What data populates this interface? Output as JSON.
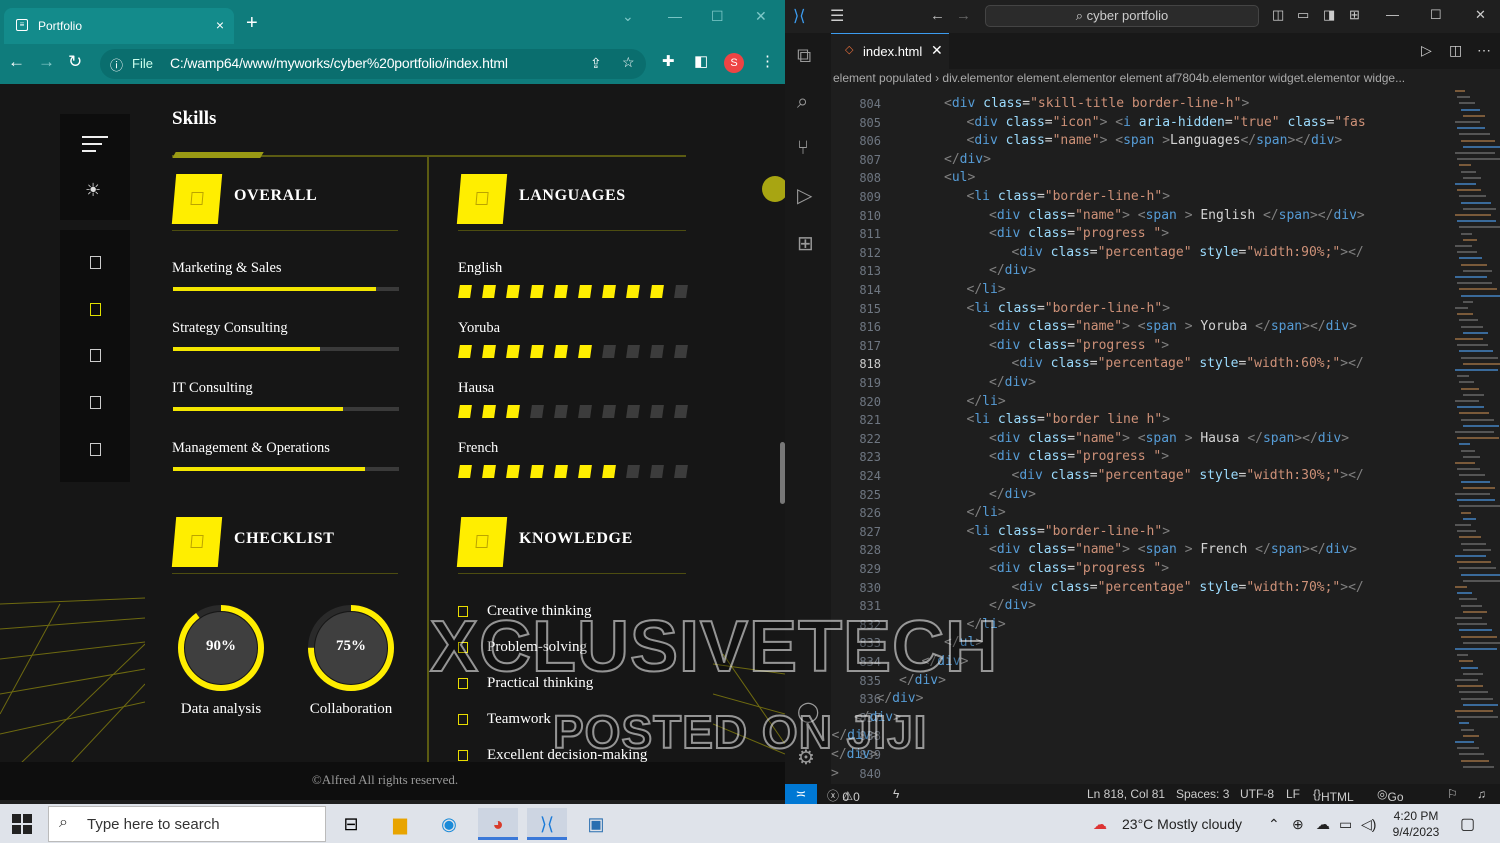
{
  "browser": {
    "tab_title": "Portfolio",
    "tab_close": "×",
    "new_tab": "+",
    "file_label": "File",
    "url": "C:/wamp64/www/myworks/cyber%20portfolio/index.html",
    "avatar_letter": "S"
  },
  "site": {
    "section_title": "Skills",
    "overall": {
      "title": "OVERALL",
      "skills": [
        {
          "name": "Marketing & Sales",
          "percent": 90
        },
        {
          "name": "Strategy Consulting",
          "percent": 65
        },
        {
          "name": "IT Consulting",
          "percent": 75
        },
        {
          "name": "Management & Operations",
          "percent": 85
        }
      ]
    },
    "languages": {
      "title": "LANGUAGES",
      "items": [
        {
          "name": "English",
          "percent": 90
        },
        {
          "name": "Yoruba",
          "percent": 60
        },
        {
          "name": "Hausa",
          "percent": 30
        },
        {
          "name": "French",
          "percent": 70
        }
      ]
    },
    "checklist": {
      "title": "CHECKLIST",
      "items": [
        {
          "label": "Data analysis",
          "value": "90%",
          "percent": 90
        },
        {
          "label": "Collaboration",
          "value": "75%",
          "percent": 75
        }
      ]
    },
    "knowledge": {
      "title": "KNOWLEDGE",
      "items": [
        "Creative thinking",
        "Problem-solving",
        "Practical thinking",
        "Teamwork",
        "Excellent decision-making"
      ]
    },
    "footer": "©Alfred All rights reserved."
  },
  "vscode": {
    "search": "cyber portfolio",
    "tab": "index.html",
    "breadcrumb": "element populated  ›  div.elementor element.elementor element af7804b.elementor widget.elementor widge...",
    "status": {
      "errors": "0",
      "warnings": "0",
      "position": "Ln 818, Col 81",
      "spaces": "Spaces: 3",
      "encoding": "UTF-8",
      "eol": "LF",
      "language": "HTML",
      "golive": "Go Live"
    },
    "current_line": "818",
    "code": [
      {
        "n": "804",
        "i": 0,
        "h": "<span class='p'>&lt;</span><span class='t'>div</span> <span class='a'>class</span>=<span class='s'>\"skill-title border-line-h\"</span><span class='p'>&gt;</span>"
      },
      {
        "n": "805",
        "i": 1,
        "h": "<span class='p'>&lt;</span><span class='t'>div</span> <span class='a'>class</span>=<span class='s'>\"icon\"</span><span class='p'>&gt;</span> <span class='p'>&lt;</span><span class='t'>i</span> <span class='a'>aria-hidden</span>=<span class='s'>\"true\"</span> <span class='a'>class</span>=<span class='s'>\"fas</span>"
      },
      {
        "n": "806",
        "i": 1,
        "h": "<span class='p'>&lt;</span><span class='t'>div</span> <span class='a'>class</span>=<span class='s'>\"name\"</span><span class='p'>&gt;</span> <span class='p'>&lt;</span><span class='t'>span</span> <span class='p'>&gt;</span>Languages<span class='p'>&lt;/</span><span class='t'>span</span><span class='p'>&gt;&lt;/</span><span class='t'>div</span><span class='p'>&gt;</span>"
      },
      {
        "n": "807",
        "i": 0,
        "h": "<span class='p'>&lt;/</span><span class='t'>div</span><span class='p'>&gt;</span>"
      },
      {
        "n": "808",
        "i": 0,
        "h": "<span class='p'>&lt;</span><span class='t'>ul</span><span class='p'>&gt;</span>"
      },
      {
        "n": "809",
        "i": 1,
        "h": "<span class='p'>&lt;</span><span class='t'>li</span> <span class='a'>class</span>=<span class='s'>\"border-line-h\"</span><span class='p'>&gt;</span>"
      },
      {
        "n": "810",
        "i": 2,
        "h": "<span class='p'>&lt;</span><span class='t'>div</span> <span class='a'>class</span>=<span class='s'>\"name\"</span><span class='p'>&gt;</span> <span class='p'>&lt;</span><span class='t'>span</span> <span class='p'>&gt;</span> English <span class='p'>&lt;/</span><span class='t'>span</span><span class='p'>&gt;&lt;/</span><span class='t'>div</span><span class='p'>&gt;</span>"
      },
      {
        "n": "811",
        "i": 2,
        "h": "<span class='p'>&lt;</span><span class='t'>div</span> <span class='a'>class</span>=<span class='s'>\"progress \"</span><span class='p'>&gt;</span>"
      },
      {
        "n": "812",
        "i": 3,
        "h": "<span class='p'>&lt;</span><span class='t'>div</span> <span class='a'>class</span>=<span class='s'>\"percentage\"</span> <span class='a'>style</span>=<span class='s'>\"width:90%;\"</span><span class='p'>&gt;&lt;/</span>"
      },
      {
        "n": "813",
        "i": 2,
        "h": "<span class='p'>&lt;/</span><span class='t'>div</span><span class='p'>&gt;</span>"
      },
      {
        "n": "814",
        "i": 1,
        "h": "<span class='p'>&lt;/</span><span class='t'>li</span><span class='p'>&gt;</span>"
      },
      {
        "n": "815",
        "i": 1,
        "h": "<span class='p'>&lt;</span><span class='t'>li</span> <span class='a'>class</span>=<span class='s'>\"border-line-h\"</span><span class='p'>&gt;</span>"
      },
      {
        "n": "816",
        "i": 2,
        "h": "<span class='p'>&lt;</span><span class='t'>div</span> <span class='a'>class</span>=<span class='s'>\"name\"</span><span class='p'>&gt;</span> <span class='p'>&lt;</span><span class='t'>span</span> <span class='p'>&gt;</span> Yoruba <span class='p'>&lt;/</span><span class='t'>span</span><span class='p'>&gt;&lt;/</span><span class='t'>div</span><span class='p'>&gt;</span>"
      },
      {
        "n": "817",
        "i": 2,
        "h": "<span class='p'>&lt;</span><span class='t'>div</span> <span class='a'>class</span>=<span class='s'>\"progress \"</span><span class='p'>&gt;</span>"
      },
      {
        "n": "818",
        "i": 3,
        "h": "<span class='p'>&lt;</span><span class='t'>div</span> <span class='a'>class</span>=<span class='s'>\"percentage\"</span> <span class='a'>style</span>=<span class='s'>\"width:60%;\"</span><span class='p'>&gt;&lt;/</span>"
      },
      {
        "n": "819",
        "i": 2,
        "h": "<span class='p'>&lt;/</span><span class='t'>div</span><span class='p'>&gt;</span>"
      },
      {
        "n": "820",
        "i": 1,
        "h": "<span class='p'>&lt;/</span><span class='t'>li</span><span class='p'>&gt;</span>"
      },
      {
        "n": "821",
        "i": 1,
        "h": "<span class='p'>&lt;</span><span class='t'>li</span> <span class='a'>class</span>=<span class='s'>\"border line h\"</span><span class='p'>&gt;</span>"
      },
      {
        "n": "822",
        "i": 2,
        "h": "<span class='p'>&lt;</span><span class='t'>div</span> <span class='a'>class</span>=<span class='s'>\"name\"</span><span class='p'>&gt;</span> <span class='p'>&lt;</span><span class='t'>span</span> <span class='p'>&gt;</span> Hausa <span class='p'>&lt;/</span><span class='t'>span</span><span class='p'>&gt;&lt;/</span><span class='t'>div</span><span class='p'>&gt;</span>"
      },
      {
        "n": "823",
        "i": 2,
        "h": "<span class='p'>&lt;</span><span class='t'>div</span> <span class='a'>class</span>=<span class='s'>\"progress \"</span><span class='p'>&gt;</span>"
      },
      {
        "n": "824",
        "i": 3,
        "h": "<span class='p'>&lt;</span><span class='t'>div</span> <span class='a'>class</span>=<span class='s'>\"percentage\"</span> <span class='a'>style</span>=<span class='s'>\"width:30%;\"</span><span class='p'>&gt;&lt;/</span>"
      },
      {
        "n": "825",
        "i": 2,
        "h": "<span class='p'>&lt;/</span><span class='t'>div</span><span class='p'>&gt;</span>"
      },
      {
        "n": "826",
        "i": 1,
        "h": "<span class='p'>&lt;/</span><span class='t'>li</span><span class='p'>&gt;</span>"
      },
      {
        "n": "827",
        "i": 1,
        "h": "<span class='p'>&lt;</span><span class='t'>li</span> <span class='a'>class</span>=<span class='s'>\"border-line-h\"</span><span class='p'>&gt;</span>"
      },
      {
        "n": "828",
        "i": 2,
        "h": "<span class='p'>&lt;</span><span class='t'>div</span> <span class='a'>class</span>=<span class='s'>\"name\"</span><span class='p'>&gt;</span> <span class='p'>&lt;</span><span class='t'>span</span> <span class='p'>&gt;</span> French <span class='p'>&lt;/</span><span class='t'>span</span><span class='p'>&gt;&lt;/</span><span class='t'>div</span><span class='p'>&gt;</span>"
      },
      {
        "n": "829",
        "i": 2,
        "h": "<span class='p'>&lt;</span><span class='t'>div</span> <span class='a'>class</span>=<span class='s'>\"progress \"</span><span class='p'>&gt;</span>"
      },
      {
        "n": "830",
        "i": 3,
        "h": "<span class='p'>&lt;</span><span class='t'>div</span> <span class='a'>class</span>=<span class='s'>\"percentage\"</span> <span class='a'>style</span>=<span class='s'>\"width:70%;\"</span><span class='p'>&gt;&lt;/</span>"
      },
      {
        "n": "831",
        "i": 2,
        "h": "<span class='p'>&lt;/</span><span class='t'>div</span><span class='p'>&gt;</span>"
      },
      {
        "n": "832",
        "i": 1,
        "h": "<span class='p'>&lt;/</span><span class='t'>li</span><span class='p'>&gt;</span>"
      },
      {
        "n": "833",
        "i": 0,
        "h": "<span class='p'>&lt;/</span><span class='t'>ul</span><span class='p'>&gt;</span>"
      },
      {
        "n": "834",
        "i": -1,
        "h": "<span class='p'>&lt;/</span><span class='t'>div</span><span class='p'>&gt;</span>"
      },
      {
        "n": "835",
        "i": -2,
        "h": "<span class='p'>&lt;/</span><span class='t'>div</span><span class='p'>&gt;</span>"
      },
      {
        "n": "836",
        "i": -3,
        "h": "<span class='p'>&lt;/</span><span class='t'>div</span><span class='p'>&gt;</span>"
      },
      {
        "n": "837",
        "i": -4,
        "h": "<span class='p'>&lt;/</span><span class='t'>div</span><span class='p'>&gt;</span>"
      },
      {
        "n": "838",
        "i": -5,
        "h": "<span class='p'>&lt;/</span><span class='t'>div</span><span class='p'>&gt;</span>"
      },
      {
        "n": "839",
        "i": -6,
        "h": "<span class='p'>&lt;/</span><span class='t'>div</span><span class='p'>&gt;</span>"
      },
      {
        "n": "840",
        "i": -6,
        "h": "<span class='p'>&gt;</span>"
      }
    ]
  },
  "taskbar": {
    "search_placeholder": "Type here to search",
    "weather": "23°C  Mostly cloudy",
    "time": "4:20 PM",
    "date": "9/4/2023"
  },
  "watermark": {
    "line1": "XCLUSIVETECH",
    "line2": "POSTED ON JIJI"
  },
  "colors": {
    "accent_yellow": "#ffee00",
    "chrome_teal": "#0f7c7c",
    "vscode_blue": "#0078d4"
  }
}
